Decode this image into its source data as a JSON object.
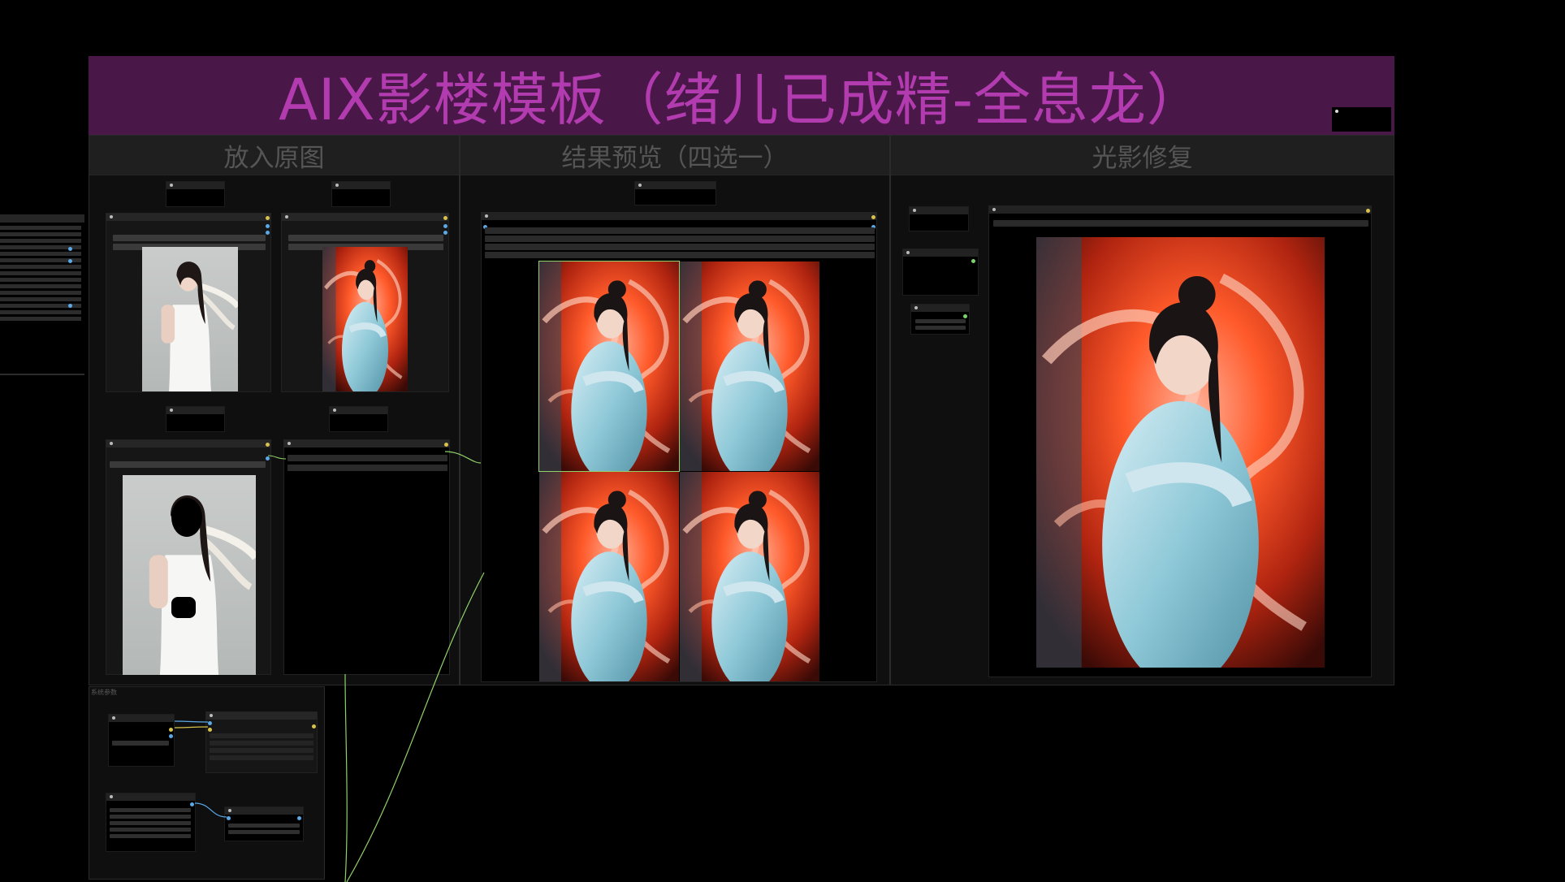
{
  "title_banner": {
    "text": "AIX影楼模板（绪儿已成精-全息龙）"
  },
  "groups": [
    {
      "id": "input",
      "label": "放入原图"
    },
    {
      "id": "preview",
      "label": "结果预览（四选一）"
    },
    {
      "id": "relight",
      "label": "光影修复"
    }
  ],
  "subgroup": {
    "label": "系统参数"
  },
  "colors": {
    "banner_bg": "#4a1848",
    "banner_text": "#b33bb0",
    "canvas_bg": "#000000",
    "link_green": "#8fd16a",
    "link_blue": "#5aa9e6",
    "link_yellow": "#d8c24a"
  },
  "images": [
    {
      "name": "original-portrait",
      "description_icon": "portrait-photo-icon"
    },
    {
      "name": "dragon-scene-reference",
      "description_icon": "scene-photo-icon"
    },
    {
      "name": "masked-portrait",
      "description_icon": "masked-photo-icon"
    },
    {
      "name": "result-1",
      "description_icon": "result-photo-icon"
    },
    {
      "name": "result-2",
      "description_icon": "result-photo-icon"
    },
    {
      "name": "result-3",
      "description_icon": "result-photo-icon"
    },
    {
      "name": "result-4",
      "description_icon": "result-photo-icon"
    },
    {
      "name": "relit-final",
      "description_icon": "final-photo-icon"
    }
  ]
}
